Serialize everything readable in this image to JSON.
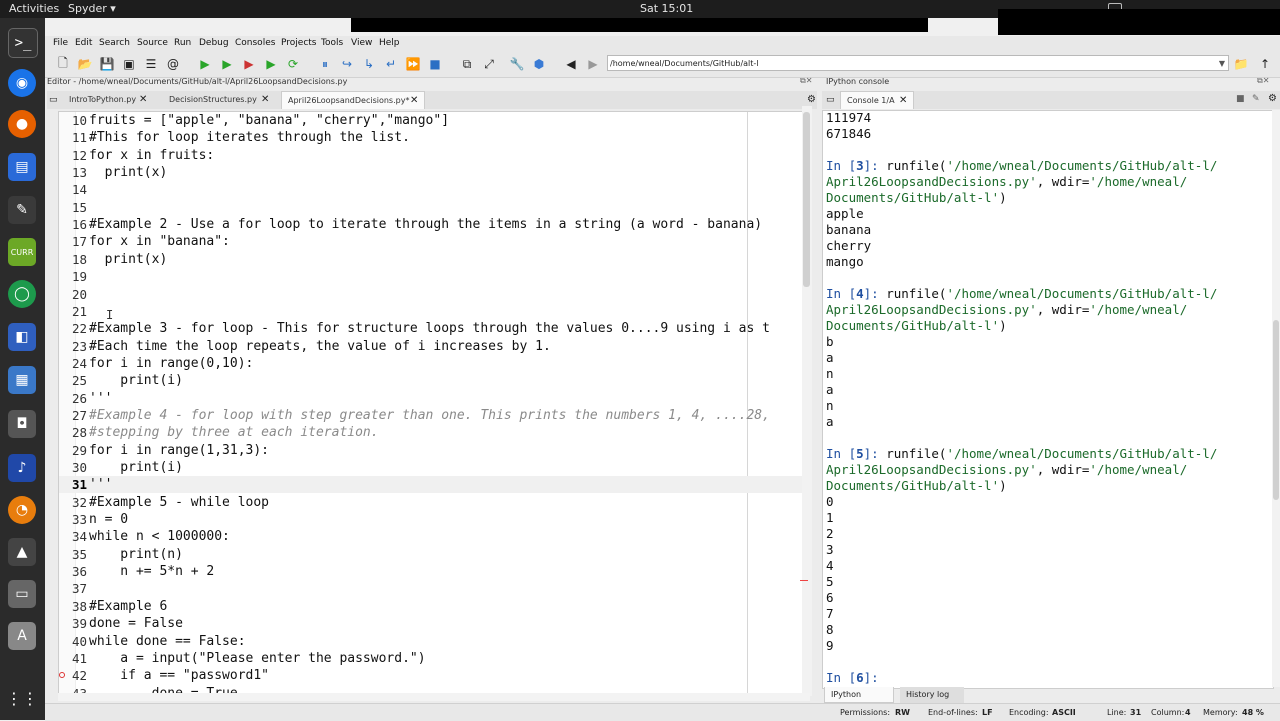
{
  "topbar": {
    "activities": "Activities",
    "app": "Spyder ▾",
    "clock": "Sat 15:01"
  },
  "menu": [
    "File",
    "Edit",
    "Search",
    "Source",
    "Run",
    "Debug",
    "Consoles",
    "Projects",
    "Tools",
    "View",
    "Help"
  ],
  "toolbar": {
    "path": "/home/wneal/Documents/GitHub/alt-l"
  },
  "editor": {
    "title": "Editor - /home/wneal/Documents/GitHub/alt-l/April26LoopsandDecisions.py",
    "tabs": [
      "IntroToPython.py",
      "DecisionStructures.py",
      "April26LoopsandDecisions.py*"
    ],
    "lines": [
      {
        "n": "10",
        "t": "fruits = [\"apple\", \"banana\", \"cherry\",\"mango\"]"
      },
      {
        "n": "11",
        "t": "#This for loop iterates through the list."
      },
      {
        "n": "12",
        "t": "for x in fruits:"
      },
      {
        "n": "13",
        "t": "  print(x)"
      },
      {
        "n": "14",
        "t": ""
      },
      {
        "n": "15",
        "t": ""
      },
      {
        "n": "16",
        "t": "#Example 2 - Use a for loop to iterate through the items in a string (a word - banana)"
      },
      {
        "n": "17",
        "t": "for x in \"banana\":"
      },
      {
        "n": "18",
        "t": "  print(x)"
      },
      {
        "n": "19",
        "t": ""
      },
      {
        "n": "20",
        "t": ""
      },
      {
        "n": "21",
        "t": ""
      },
      {
        "n": "22",
        "t": "#Example 3 - for loop - This for structure loops through the values 0....9 using i as t"
      },
      {
        "n": "23",
        "t": "#Each time the loop repeats, the value of i increases by 1."
      },
      {
        "n": "24",
        "t": "for i in range(0,10):"
      },
      {
        "n": "25",
        "t": "    print(i)"
      },
      {
        "n": "26",
        "t": "'''"
      },
      {
        "n": "27",
        "t": "#Example 4 - for loop with step greater than one. This prints the numbers 1, 4, ....28,"
      },
      {
        "n": "28",
        "t": "#stepping by three at each iteration."
      },
      {
        "n": "29",
        "t": "for i in range(1,31,3):"
      },
      {
        "n": "30",
        "t": "    print(i)"
      },
      {
        "n": "31",
        "t": "'''"
      },
      {
        "n": "32",
        "t": "#Example 5 - while loop"
      },
      {
        "n": "33",
        "t": "n = 0"
      },
      {
        "n": "34",
        "t": "while n < 1000000:"
      },
      {
        "n": "35",
        "t": "    print(n)"
      },
      {
        "n": "36",
        "t": "    n += 5*n + 2"
      },
      {
        "n": "37",
        "t": ""
      },
      {
        "n": "38",
        "t": "#Example 6"
      },
      {
        "n": "39",
        "t": "done = False"
      },
      {
        "n": "40",
        "t": "while done == False:"
      },
      {
        "n": "41",
        "t": "    a = input(\"Please enter the password.\")"
      },
      {
        "n": "42",
        "t": "    if a == \"password1\""
      },
      {
        "n": "43",
        "t": "        done = True"
      }
    ]
  },
  "console": {
    "title": "IPython console",
    "tab": "Console 1/A",
    "lines": [
      {
        "t": "111974"
      },
      {
        "t": "671846"
      },
      {
        "t": ""
      },
      {
        "p": "In [",
        "n": "3",
        "s": "]: ",
        "t": "runfile(",
        "str": "'/home/wneal/Documents/GitHub/alt-l/"
      },
      {
        "str": "April26LoopsandDecisions.py'",
        "t": ", wdir=",
        "str2": "'/home/wneal/"
      },
      {
        "str": "Documents/GitHub/alt-l'",
        "t": ")"
      },
      {
        "t": "apple"
      },
      {
        "t": "banana"
      },
      {
        "t": "cherry"
      },
      {
        "t": "mango"
      },
      {
        "t": ""
      },
      {
        "p": "In [",
        "n": "4",
        "s": "]: ",
        "t": "runfile(",
        "str": "'/home/wneal/Documents/GitHub/alt-l/"
      },
      {
        "str": "April26LoopsandDecisions.py'",
        "t": ", wdir=",
        "str2": "'/home/wneal/"
      },
      {
        "str": "Documents/GitHub/alt-l'",
        "t": ")"
      },
      {
        "t": "b"
      },
      {
        "t": "a"
      },
      {
        "t": "n"
      },
      {
        "t": "a"
      },
      {
        "t": "n"
      },
      {
        "t": "a"
      },
      {
        "t": ""
      },
      {
        "p": "In [",
        "n": "5",
        "s": "]: ",
        "t": "runfile(",
        "str": "'/home/wneal/Documents/GitHub/alt-l/"
      },
      {
        "str": "April26LoopsandDecisions.py'",
        "t": ", wdir=",
        "str2": "'/home/wneal/"
      },
      {
        "str": "Documents/GitHub/alt-l'",
        "t": ")"
      },
      {
        "t": "0"
      },
      {
        "t": "1"
      },
      {
        "t": "2"
      },
      {
        "t": "3"
      },
      {
        "t": "4"
      },
      {
        "t": "5"
      },
      {
        "t": "6"
      },
      {
        "t": "7"
      },
      {
        "t": "8"
      },
      {
        "t": "9"
      },
      {
        "t": ""
      },
      {
        "p": "In [",
        "n": "6",
        "s": "]: ",
        "t": ""
      }
    ],
    "bottom_tabs": [
      "IPython console",
      "History log"
    ]
  },
  "status": {
    "permissions_label": "Permissions:",
    "permissions": "RW",
    "eol_label": "End-of-lines:",
    "eol": "LF",
    "encoding_label": "Encoding:",
    "encoding": "ASCII",
    "line_label": "Line:",
    "line": "31",
    "col_label": "Column:",
    "col": "4",
    "mem_label": "Memory:",
    "mem": "48 %"
  }
}
